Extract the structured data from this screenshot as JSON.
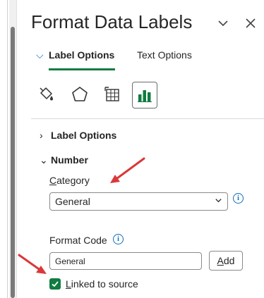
{
  "pane": {
    "title": "Format Data Labels"
  },
  "tabs": [
    {
      "label": "Label Options",
      "active": true
    },
    {
      "label": "Text Options",
      "active": false
    }
  ],
  "icon_tabs": [
    {
      "name": "fill-line-icon"
    },
    {
      "name": "effects-icon"
    },
    {
      "name": "size-properties-icon"
    },
    {
      "name": "label-options-chart-icon",
      "selected": true
    }
  ],
  "sections": {
    "label_options": "Label Options",
    "number": "Number"
  },
  "number": {
    "category_label_prefix": "C",
    "category_label_rest": "ategory",
    "category_value": "General",
    "format_code_label": "Format Code",
    "format_code_value": "General",
    "add_button_prefix": "A",
    "add_button_rest": "dd",
    "linked_prefix": "L",
    "linked_rest": "inked to source",
    "linked_checked": true
  },
  "colors": {
    "accent_green": "#107c41",
    "accent_blue": "#0f6cbd",
    "annotation_red": "#d9383a"
  }
}
